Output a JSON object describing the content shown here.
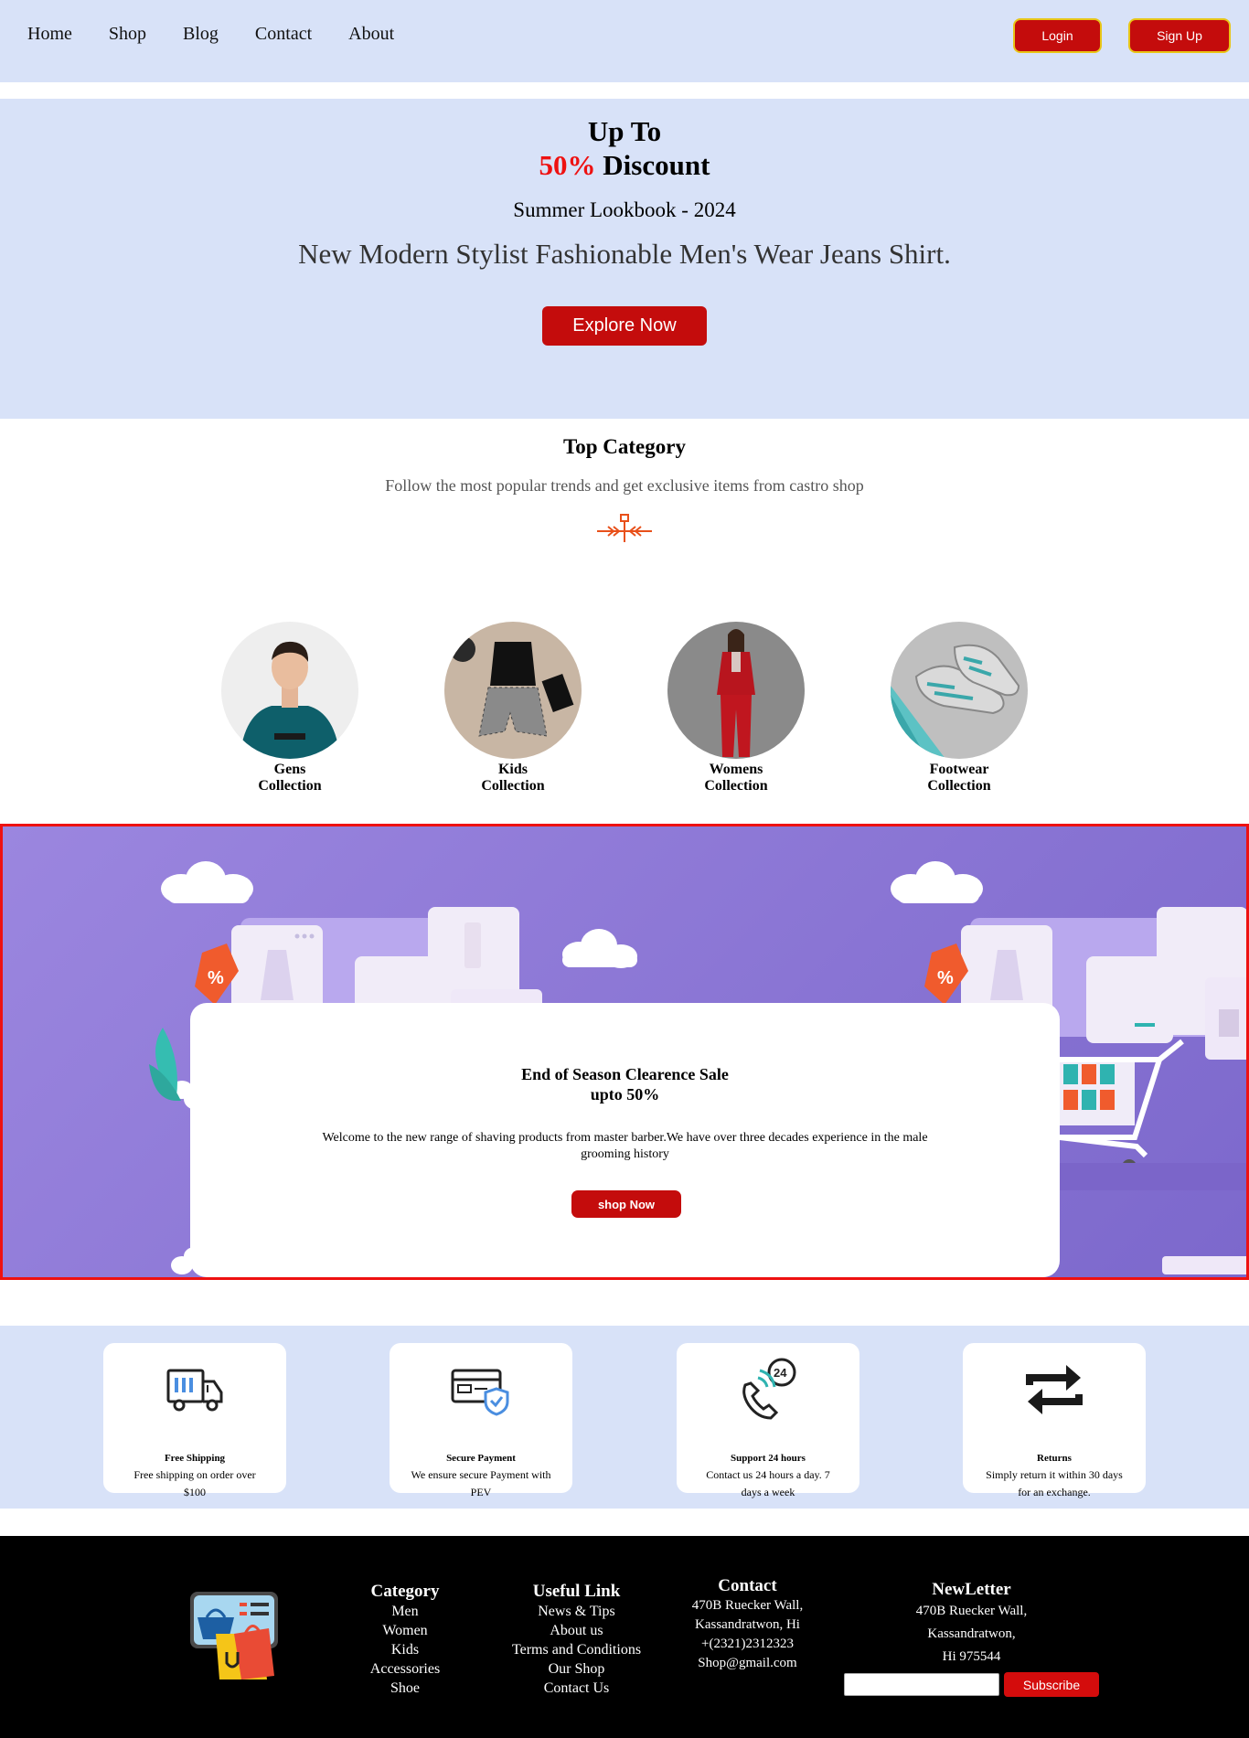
{
  "nav": {
    "links": [
      "Home",
      "Shop",
      "Blog",
      "Contact",
      "About"
    ],
    "login_label": "Login",
    "signup_label": "Sign Up"
  },
  "hero": {
    "line1": "Up To",
    "percent": "50%",
    "discount": "Discount",
    "subtitle": "Summer Lookbook - 2024",
    "description": "New Modern Stylist Fashionable Men's Wear Jeans Shirt.",
    "cta_label": "Explore Now"
  },
  "top_category": {
    "title": "Top Category",
    "subtitle": "Follow the most popular trends and get exclusive items from castro shop",
    "items": [
      {
        "line1": "Gens",
        "line2": "Collection"
      },
      {
        "line1": "Kids",
        "line2": "Collection"
      },
      {
        "line1": "Womens",
        "line2": "Collection"
      },
      {
        "line1": "Footwear",
        "line2": "Collection"
      }
    ]
  },
  "banner": {
    "title_line1": "End of Season Clearence Sale",
    "title_line2": "upto 50%",
    "text": "Welcome to the new range of shaving products from master barber.We have over three decades experience in the male grooming history",
    "cta_label": "shop Now"
  },
  "features": [
    {
      "icon": "delivery-truck-icon",
      "title": "Free Shipping",
      "desc": "Free shipping on order over $100"
    },
    {
      "icon": "secure-card-icon",
      "title": "Secure Payment",
      "desc": "We ensure secure Payment with PEV"
    },
    {
      "icon": "support-24-icon",
      "title": "Support 24 hours",
      "desc": "Contact us 24 hours a day. 7 days a week"
    },
    {
      "icon": "returns-icon",
      "title": "Returns",
      "desc": "Simply return it within 30 days for an exchange."
    }
  ],
  "footer": {
    "category": {
      "title": "Category",
      "links": [
        "Men",
        "Women",
        "Kids",
        "Accessories",
        "Shoe"
      ]
    },
    "useful": {
      "title": "Useful Link",
      "links": [
        "News & Tips",
        "About us",
        "Terms and Conditions",
        "Our Shop",
        "Contact Us"
      ]
    },
    "contact": {
      "title": "Contact",
      "lines": [
        "470B Ruecker Wall,",
        "Kassandratwon, Hi",
        "+(2321)2312323",
        "Shop@gmail.com"
      ]
    },
    "newsletter": {
      "title": "NewLetter",
      "lines": [
        "470B Ruecker Wall,",
        "Kassandratwon,",
        "Hi 975544"
      ],
      "input_value": "",
      "subscribe_label": "Subscribe"
    }
  },
  "colors": {
    "accent": "#c40c0c",
    "nav_bg": "#d8e2f8",
    "highlight": "#ee1111",
    "banner_bg": "#8d78d6"
  }
}
